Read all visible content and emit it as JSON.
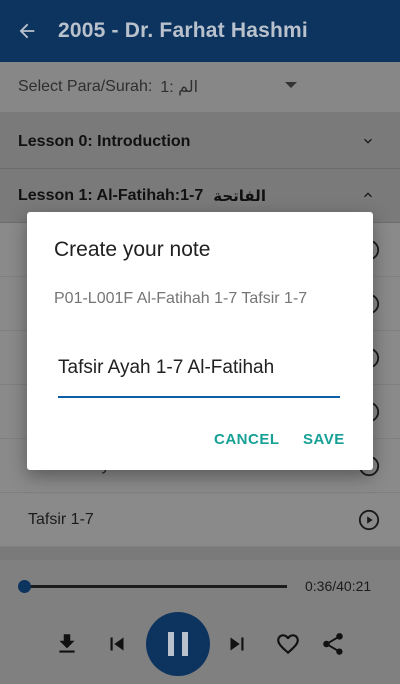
{
  "appbar": {
    "title": "2005 - Dr. Farhat Hashmi"
  },
  "selector": {
    "label": "Select Para/Surah:",
    "value": "1: الم"
  },
  "lessons": [
    {
      "label": "Lesson 0: Introduction",
      "arabic": ""
    },
    {
      "label": "Lesson 1: Al-Fatihah:1-7",
      "arabic": "الفاتحة"
    }
  ],
  "rows": [
    {
      "label": ""
    },
    {
      "label": ""
    },
    {
      "label": ""
    },
    {
      "label": ""
    },
    {
      "label": "Word Analysis"
    },
    {
      "label": "Tafsir 1-7"
    }
  ],
  "player": {
    "time": "0:36/40:21",
    "progress": 0.015
  },
  "dialog": {
    "title": "Create your note",
    "subtitle": "P01-L001F Al-Fatihah 1-7 Tafsir 1-7",
    "input_value": "Tafsir Ayah 1-7 Al-Fatihah",
    "cancel_label": "CANCEL",
    "save_label": "SAVE"
  },
  "colors": {
    "appbar": "#0d335f",
    "accent": "#16a096",
    "underline": "#0e5fa8"
  }
}
